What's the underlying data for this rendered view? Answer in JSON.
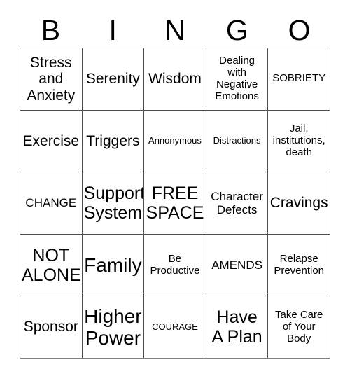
{
  "card": {
    "title": "BINGO",
    "header_letters": [
      "B",
      "I",
      "N",
      "G",
      "O"
    ],
    "colors": {
      "background": "#ffffff",
      "text": "#000000",
      "grid_line": "#4d4d4d"
    },
    "rows": [
      [
        {
          "text": "Stress\nand\nAnxiety",
          "size": "fs-md"
        },
        {
          "text": "Serenity",
          "size": "fs-md"
        },
        {
          "text": "Wisdom",
          "size": "fs-md"
        },
        {
          "text": "Dealing\nwith\nNegative\nEmotions",
          "size": "fs-xs"
        },
        {
          "text": "SOBRIETY",
          "size": "fs-xs"
        }
      ],
      [
        {
          "text": "Exercise",
          "size": "fs-md"
        },
        {
          "text": "Triggers",
          "size": "fs-md"
        },
        {
          "text": "Annonymous",
          "size": "fs-xxs"
        },
        {
          "text": "Distractions",
          "size": "fs-xxs"
        },
        {
          "text": "Jail,\ninstitutions,\ndeath",
          "size": "fs-xs"
        }
      ],
      [
        {
          "text": "CHANGE",
          "size": "fs-sm"
        },
        {
          "text": "Support\nSystem",
          "size": "fs-lg"
        },
        {
          "text": "FREE\nSPACE",
          "size": "fs-lg"
        },
        {
          "text": "Character\nDefects",
          "size": "fs-sm"
        },
        {
          "text": "Cravings",
          "size": "fs-md"
        }
      ],
      [
        {
          "text": "NOT\nALONE",
          "size": "fs-lg"
        },
        {
          "text": "Family",
          "size": "fs-xl"
        },
        {
          "text": "Be\nProductive",
          "size": "fs-xs"
        },
        {
          "text": "AMENDS",
          "size": "fs-sm"
        },
        {
          "text": "Relapse\nPrevention",
          "size": "fs-xs"
        }
      ],
      [
        {
          "text": "Sponsor",
          "size": "fs-md"
        },
        {
          "text": "Higher\nPower",
          "size": "fs-xl"
        },
        {
          "text": "COURAGE",
          "size": "fs-xxs"
        },
        {
          "text": "Have\nA Plan",
          "size": "fs-lg"
        },
        {
          "text": "Take Care\nof Your\nBody",
          "size": "fs-xs"
        }
      ]
    ]
  }
}
